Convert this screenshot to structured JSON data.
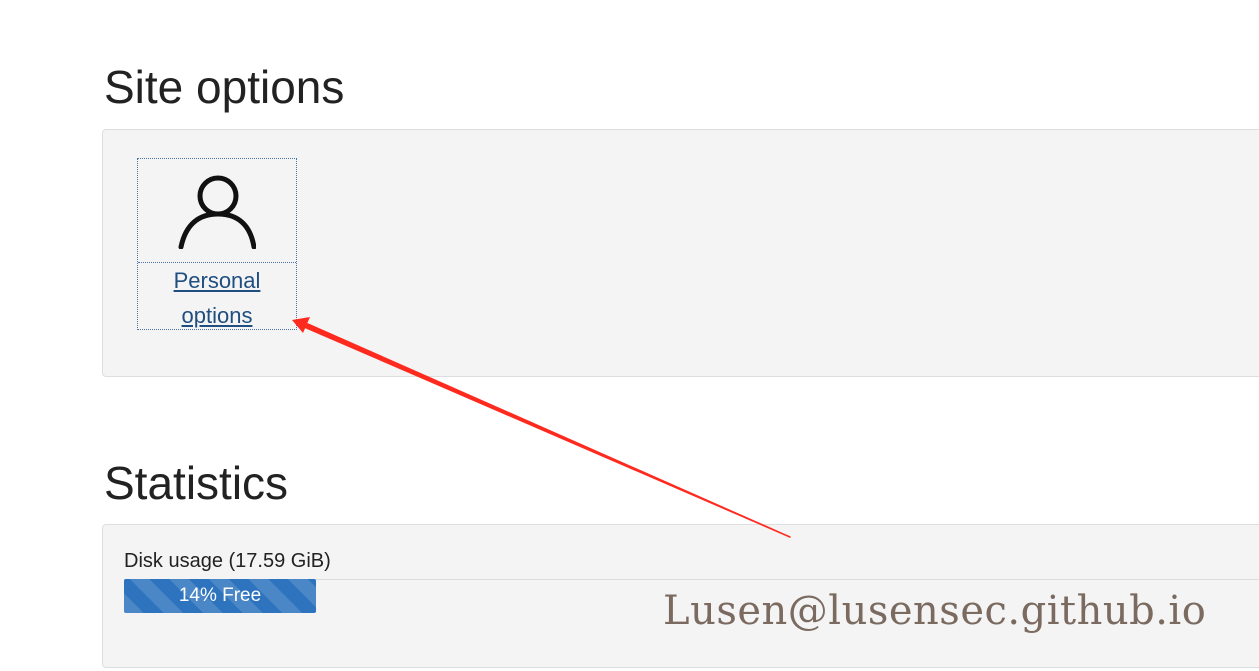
{
  "site_options": {
    "title": "Site options",
    "tiles": [
      {
        "label_line1": "Personal",
        "label_line2": "options",
        "icon": "user-icon"
      }
    ]
  },
  "statistics": {
    "title": "Statistics",
    "disk_usage_label": "Disk usage (17.59 GiB)",
    "free_percent": 14,
    "free_label": "14% Free"
  },
  "watermark": "Lusen@lusensec.github.io",
  "colors": {
    "panel_bg": "#f4f4f4",
    "link": "#1f4e80",
    "progress": "#2d73be",
    "annotation_arrow": "#ff2a1f"
  }
}
